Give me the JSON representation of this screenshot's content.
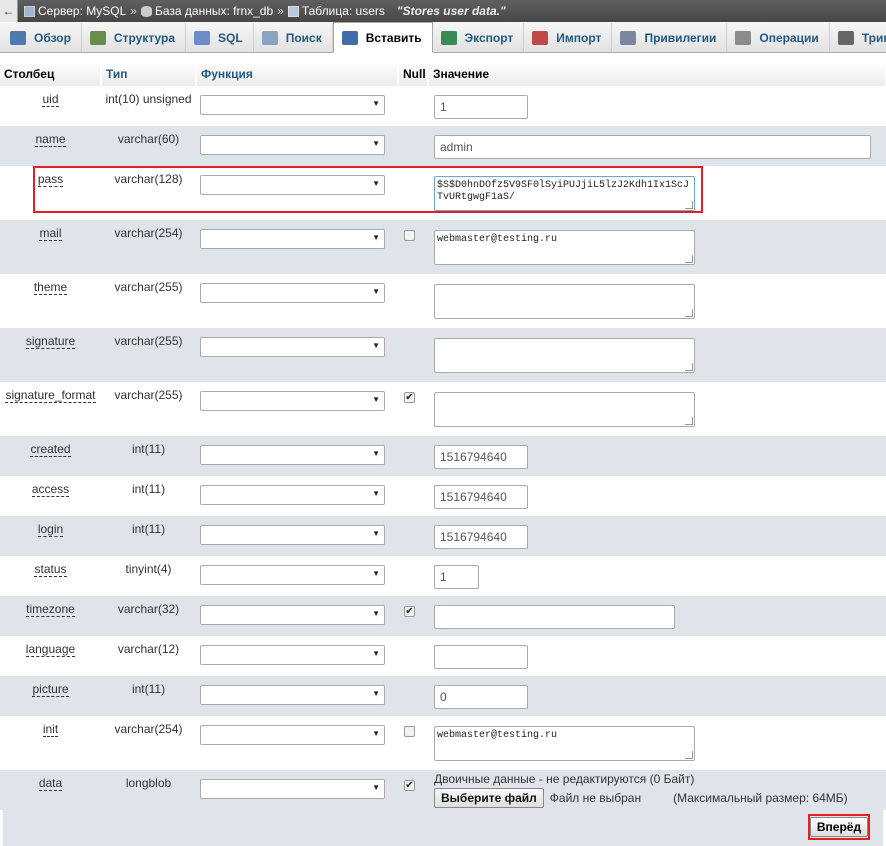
{
  "breadcrumb": {
    "back": "←",
    "server": "Сервер: MySQL",
    "database": "База данных: frnx_db",
    "table": "Таблица: users",
    "separator": "»",
    "comment": "\"Stores user data.\""
  },
  "tabs": [
    {
      "label": "Обзор",
      "icon": "browse-icon",
      "color": "#4f7ab0"
    },
    {
      "label": "Структура",
      "icon": "structure-icon",
      "color": "#6a8d4a"
    },
    {
      "label": "SQL",
      "icon": "sql-icon",
      "color": "#6a8fc7"
    },
    {
      "label": "Поиск",
      "icon": "search-icon",
      "color": "#8aa3c2"
    },
    {
      "label": "Вставить",
      "icon": "insert-icon",
      "color": "#3f6ea8"
    },
    {
      "label": "Экспорт",
      "icon": "export-icon",
      "color": "#3a8a55"
    },
    {
      "label": "Импорт",
      "icon": "import-icon",
      "color": "#c04a4a"
    },
    {
      "label": "Привилегии",
      "icon": "privileges-icon",
      "color": "#7b86a0"
    },
    {
      "label": "Операции",
      "icon": "operations-icon",
      "color": "#8b8b8b"
    },
    {
      "label": "Триггеры",
      "icon": "triggers-icon",
      "color": "#666"
    }
  ],
  "active_tab": "Вставить",
  "headers": {
    "column": "Столбец",
    "type": "Тип",
    "function": "Функция",
    "null": "Null",
    "value": "Значение"
  },
  "rows": [
    {
      "name": "uid",
      "type": "int(10) unsigned",
      "null": "none",
      "kind": "input",
      "value": "1"
    },
    {
      "name": "name",
      "type": "varchar(60)",
      "null": "none",
      "kind": "input-wide",
      "value": "admin"
    },
    {
      "name": "pass",
      "type": "varchar(128)",
      "null": "none",
      "kind": "textarea",
      "value": "$S$D0hnDOfz5V9SF0lSyiPUJjiL5lzJ2Kdh1Ix1ScJTvURtgwgF1aS/"
    },
    {
      "name": "mail",
      "type": "varchar(254)",
      "null": "unchecked",
      "kind": "textarea",
      "value": "webmaster@testing.ru"
    },
    {
      "name": "theme",
      "type": "varchar(255)",
      "null": "none",
      "kind": "textarea",
      "value": ""
    },
    {
      "name": "signature",
      "type": "varchar(255)",
      "null": "none",
      "kind": "textarea",
      "value": ""
    },
    {
      "name": "signature_format",
      "type": "varchar(255)",
      "null": "checked",
      "kind": "textarea",
      "value": ""
    },
    {
      "name": "created",
      "type": "int(11)",
      "null": "none",
      "kind": "input",
      "value": "1516794640"
    },
    {
      "name": "access",
      "type": "int(11)",
      "null": "none",
      "kind": "input",
      "value": "1516794640"
    },
    {
      "name": "login",
      "type": "int(11)",
      "null": "none",
      "kind": "input",
      "value": "1516794640"
    },
    {
      "name": "status",
      "type": "tinyint(4)",
      "null": "none",
      "kind": "input-small",
      "value": "1"
    },
    {
      "name": "timezone",
      "type": "varchar(32)",
      "null": "checked",
      "kind": "input-medium",
      "value": ""
    },
    {
      "name": "language",
      "type": "varchar(12)",
      "null": "none",
      "kind": "input",
      "value": ""
    },
    {
      "name": "picture",
      "type": "int(11)",
      "null": "none",
      "kind": "input",
      "value": "0"
    },
    {
      "name": "init",
      "type": "varchar(254)",
      "null": "unchecked",
      "kind": "textarea",
      "value": "webmaster@testing.ru"
    },
    {
      "name": "data",
      "type": "longblob",
      "null": "checked",
      "kind": "file",
      "value": ""
    }
  ],
  "binary": {
    "note": "Двоичные данные - не редактируются (0 Байт)",
    "choose_file": "Выберите файл",
    "no_file": "Файл не выбран",
    "max_size": "(Максимальный размер: 64МБ)"
  },
  "go_button": "Вперёд",
  "colors": {
    "highlight": "#e31e24",
    "row_even": "#dfe3ea",
    "link": "#235a81"
  }
}
